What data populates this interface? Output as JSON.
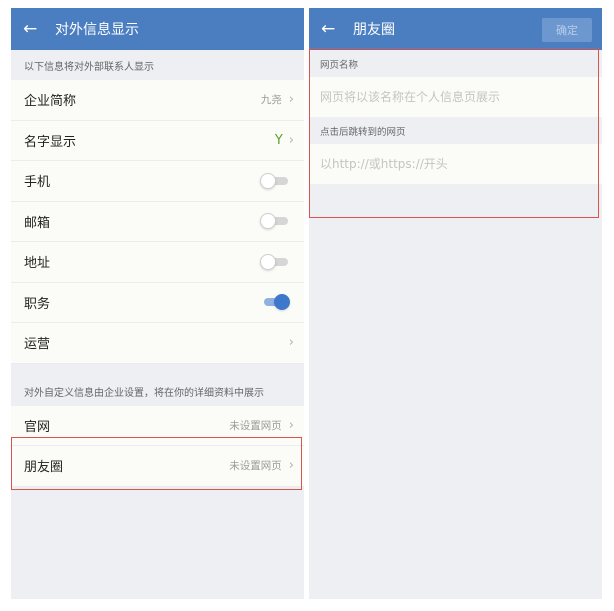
{
  "left": {
    "title": "对外信息显示",
    "section1_label": "以下信息将对外部联系人显示",
    "rows": [
      {
        "label": "企业简称",
        "value": "九尧"
      },
      {
        "label": "名字显示"
      },
      {
        "label": "手机",
        "toggle_on": false
      },
      {
        "label": "邮箱",
        "toggle_on": false
      },
      {
        "label": "地址",
        "toggle_on": false
      },
      {
        "label": "职务",
        "toggle_on": true
      },
      {
        "label": "运营"
      }
    ],
    "section2_label": "对外自定义信息由企业设置，将在你的详细资料中展示",
    "custom_rows": [
      {
        "label": "官网",
        "value": "未设置网页"
      },
      {
        "label": "朋友圈",
        "value": "未设置网页"
      }
    ]
  },
  "right": {
    "title": "朋友圈",
    "confirm_label": "确定",
    "name_section_label": "网页名称",
    "name_placeholder": "网页将以该名称在个人信息页展示",
    "url_section_label": "点击后跳转到的网页",
    "url_placeholder": "以http://或https://开头"
  },
  "icons": {
    "back": "arrow-left-icon",
    "chevron": "chevron-right-icon",
    "sprout": "sprout-icon"
  },
  "colors": {
    "header": "#4a7ec0",
    "toggle_on": "#3d78cc",
    "highlight": "#d9534f"
  }
}
